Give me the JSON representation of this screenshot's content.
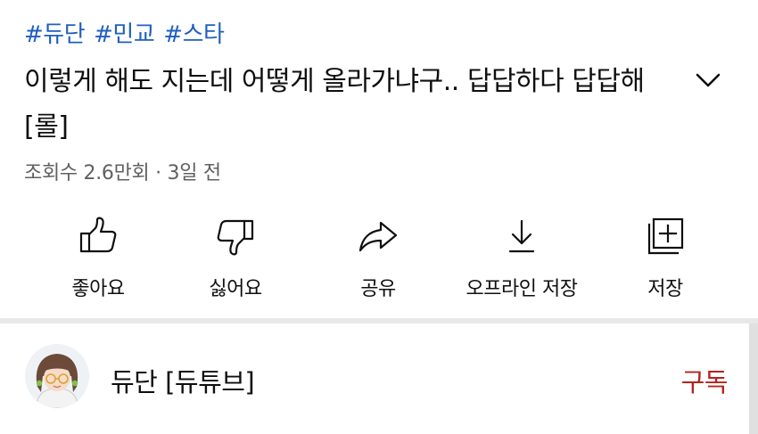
{
  "hashtags": [
    "#듀단",
    "#민교",
    "#스타"
  ],
  "video": {
    "title": "이렇게 해도 지는데 어떻게 올라가냐구.. 답답하다 답답해 [롤]",
    "meta": "조회수 2.6만회 · 3일 전"
  },
  "actions": {
    "like": "좋아요",
    "dislike": "싫어요",
    "share": "공유",
    "offline": "오프라인 저장",
    "save": "저장"
  },
  "channel": {
    "name": "듀단 [듀튜브]",
    "subscribe": "구독"
  },
  "colors": {
    "hashtag": "#1f5fbf",
    "subscribe": "#b3241c",
    "meta": "#606060"
  },
  "icons": {
    "expand": "chevron-down-icon",
    "like": "thumbs-up-icon",
    "dislike": "thumbs-down-icon",
    "share": "share-arrow-icon",
    "offline": "download-icon",
    "save": "add-to-playlist-icon"
  }
}
